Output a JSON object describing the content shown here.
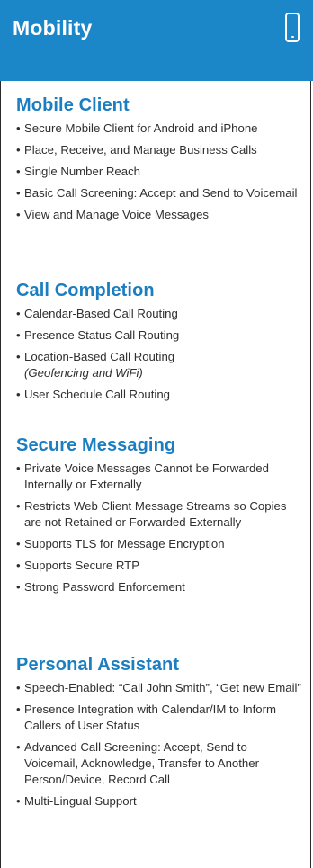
{
  "header": {
    "title": "Mobility",
    "icon": "mobile-phone-icon"
  },
  "sections": [
    {
      "title": "Mobile Client",
      "items": [
        {
          "text": "Secure Mobile Client for Android and iPhone"
        },
        {
          "text": "Place, Receive, and Manage Business Calls"
        },
        {
          "text": "Single Number Reach"
        },
        {
          "text": "Basic Call Screening: Accept and Send to Voicemail"
        },
        {
          "text": "View and Manage Voice Messages"
        }
      ]
    },
    {
      "title": "Call Completion",
      "items": [
        {
          "text": "Calendar-Based Call Routing"
        },
        {
          "text": "Presence Status Call Routing"
        },
        {
          "text": "Location-Based Call Routing",
          "sub": "(Geofencing and WiFi)"
        },
        {
          "text": "User Schedule Call Routing"
        }
      ]
    },
    {
      "title": "Secure Messaging",
      "items": [
        {
          "text": "Private Voice Messages Cannot be Forwarded Internally or Externally"
        },
        {
          "text": "Restricts Web Client Message Streams so Copies are not Retained or Forwarded Externally"
        },
        {
          "text": "Supports TLS for Message Encryption"
        },
        {
          "text": "Supports Secure RTP"
        },
        {
          "text": "Strong Password Enforcement"
        }
      ]
    },
    {
      "title": "Personal Assistant",
      "items": [
        {
          "text": "Speech-Enabled: “Call John Smith”, “Get new Email”"
        },
        {
          "text": "Presence Integration with Calendar/IM to Inform Callers of User Status"
        },
        {
          "text": "Advanced Call Screening:  Accept, Send to Voicemail, Acknowledge, Transfer to Another Person/Device, Record Call"
        },
        {
          "text": "Multi-Lingual Support"
        }
      ]
    }
  ]
}
